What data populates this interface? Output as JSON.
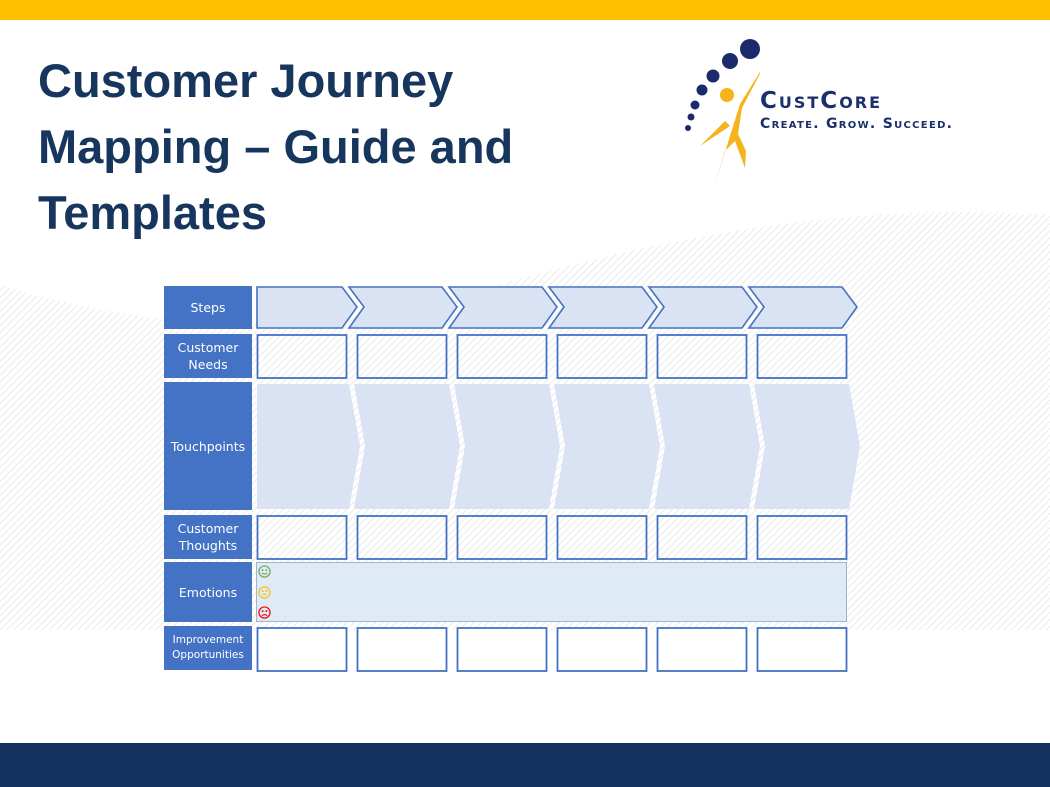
{
  "slide": {
    "title": "Customer Journey Mapping – Guide and Templates",
    "colors": {
      "top_bar": "#ffc000",
      "bottom_bar": "#13305f",
      "title": "#17365d",
      "label_fill": "#4472c4",
      "box_border": "#4472c4",
      "chevron_fill": "#dae3f3",
      "emotions_fill": "#deebf7"
    }
  },
  "logo": {
    "name": "CustCore",
    "tagline": "Create. Grow. Succeed."
  },
  "journey_map": {
    "rows": [
      {
        "label": "Steps"
      },
      {
        "label": "Customer Needs"
      },
      {
        "label": "Touchpoints"
      },
      {
        "label": "Customer Thoughts"
      },
      {
        "label": "Emotions"
      },
      {
        "label": "Improvement Opportunities"
      }
    ],
    "stage_count": 6,
    "emotion_icons": [
      {
        "icon": "happy-face-icon",
        "color": "#70ad47"
      },
      {
        "icon": "neutral-face-icon",
        "color": "#ffc000"
      },
      {
        "icon": "sad-face-icon",
        "color": "#ff0000"
      }
    ]
  }
}
